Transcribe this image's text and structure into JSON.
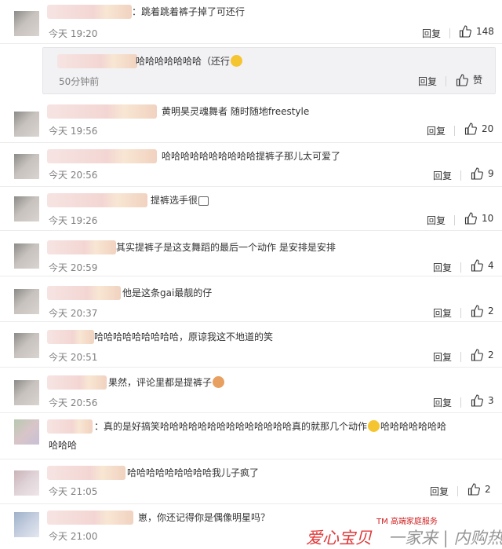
{
  "ui": {
    "reply_label": "回复",
    "like_label": "赞",
    "colors": {
      "text": "#333333",
      "time": "#808080",
      "watermark": "#e03838"
    },
    "icons": [
      "thumbs-up-icon",
      "emoji-icon"
    ]
  },
  "comments": [
    {
      "text": "：跳着跳着裤子掉了可还行",
      "time": "今天 19:20",
      "likes": "148"
    },
    {
      "text": "哈哈哈哈哈哈哈（还行",
      "time": "50分钟前",
      "likes": "赞"
    },
    {
      "text": "黄明昊灵魂舞者 随时随地freestyle",
      "time": "今天 19:56",
      "likes": "20"
    },
    {
      "text": "哈哈哈哈哈哈哈哈哈哈提裤子那儿太可爱了",
      "time": "今天 20:56",
      "likes": "9"
    },
    {
      "text": "提裤选手很",
      "time": "今天 19:26",
      "likes": "10"
    },
    {
      "text": "其实提裤子是这支舞蹈的最后一个动作 是安排是安排",
      "time": "今天 20:59",
      "likes": "4"
    },
    {
      "text": "他是这条gai最靓的仔",
      "time": "今天 20:37",
      "likes": "2"
    },
    {
      "text": "哈哈哈哈哈哈哈哈哈，原谅我这不地道的笑",
      "time": "今天 20:51",
      "likes": "2"
    },
    {
      "text": "果然，评论里都是提裤子",
      "time": "今天 20:56",
      "likes": "3"
    },
    {
      "text": "：真的是好搞笑哈哈哈哈哈哈哈哈哈哈哈哈哈哈真的就那几个动作",
      "text_cont_a": "哈哈哈哈哈哈哈",
      "text_line2": "哈哈哈",
      "time": "",
      "likes": ""
    },
    {
      "text": "哈哈哈哈哈哈哈哈哈我儿子疯了",
      "time": "今天 21:05",
      "likes": "2"
    },
    {
      "text": "崽，你还记得你是偶像明星吗？",
      "time": "今天 21:00",
      "likes": ""
    }
  ],
  "watermark": {
    "tm": "TM 高端家庭服务",
    "brand": "爱心宝贝",
    "tagline": "一家来 | 内购热点"
  }
}
